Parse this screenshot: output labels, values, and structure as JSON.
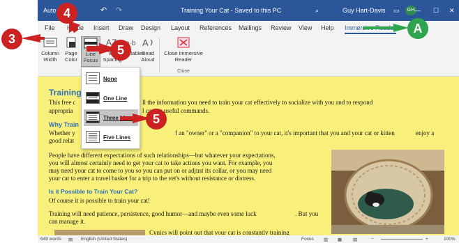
{
  "titlebar": {
    "autosave": "Auto",
    "doc_title": "Training Your Cat - Saved to this PC",
    "user": "Guy Hart-Davis",
    "user_initials": "GH"
  },
  "tabs": [
    "File",
    "Home",
    "Insert",
    "Draw",
    "Design",
    "Layout",
    "References",
    "Mailings",
    "Review",
    "View",
    "Help",
    "Immersive Reader"
  ],
  "ribbon": {
    "column_width": "Column Width",
    "page_color": "Page Color",
    "line_focus": "Line Focus",
    "text_spacing": "Text Spacing",
    "syllables": "Syllables",
    "read_aloud": "Read Aloud",
    "close_label": "Close Immersive Reader",
    "close_group": "Close"
  },
  "dropdown": {
    "items": [
      "None",
      "One Line",
      "Three Lines",
      "Five Lines"
    ]
  },
  "document": {
    "heading1": "Training",
    "para1a": "This free c",
    "para1b": "ll the information you need to train your cat effectively to socialize with you and to respond",
    "para1c": "appropria",
    "para1d": "l co",
    "para1e": "y useful commands.",
    "heading2": "Why Train",
    "para2a": "Whether y",
    "para2b": "f an \"owner\" or a \"companion\" to your cat, it's important that you and your cat or kitten",
    "para2c": "enjoy a",
    "para2d": "good relat",
    "para3": [
      "People have different expectations of such relationships—but whatever your expectations,",
      "you will almost certainly need to get your cat to take actions you want. For example, you",
      "may need your cat to come to you so you can put on or adjust its collar, or you may need",
      "your cat to enter a travel basket for a trip to the vet's without resistance or distress."
    ],
    "heading3": "Is it Possible to Train Your Cat?",
    "para4": "Of course it is possible to train your cat!",
    "para5a": "Training will need patience, persistence, good humor—and maybe even some luck",
    "para5b": ". But you",
    "para5c": "can manage it.",
    "para6": "Cynics will point out that your cat is constantly training"
  },
  "status": {
    "words": "649 words",
    "language": "English (United States)",
    "focus": "Focus",
    "zoom": "100%"
  },
  "callouts": {
    "c3": "3",
    "c4": "4",
    "c5a": "5",
    "c5b": "5",
    "cA": "A"
  },
  "colors": {
    "word_blue": "#2b579a",
    "doc_yellow": "#f8f07a",
    "callout_red": "#cc2222",
    "callout_green": "#2ea44f"
  }
}
